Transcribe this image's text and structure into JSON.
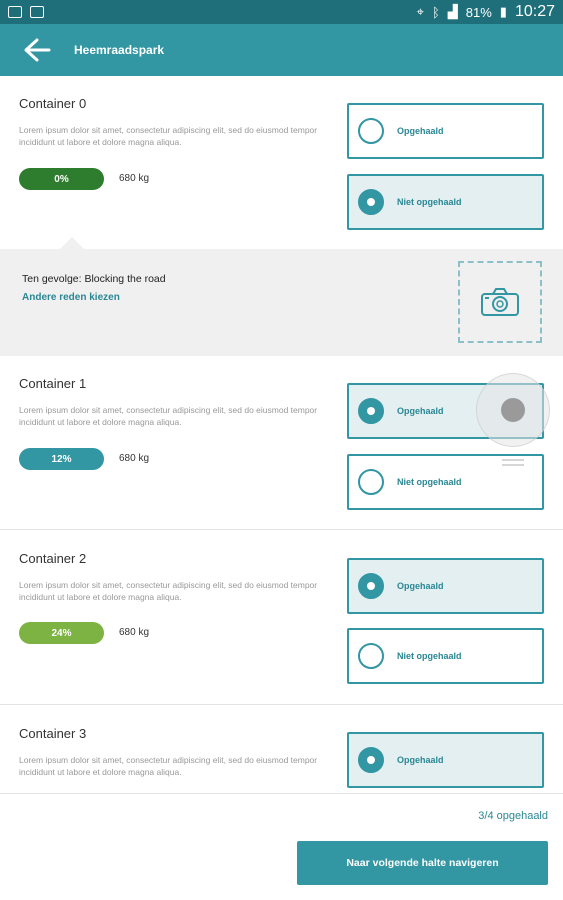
{
  "status_bar": {
    "battery": "81%",
    "time": "10:27"
  },
  "app_bar": {
    "title": "Heemraadspark"
  },
  "containers": [
    {
      "title": "Container 0",
      "description": "Lorem ipsum dolor sit amet, consectetur adipiscing elit, sed do eiusmod tempor incididunt ut labore et dolore magna aliqua.",
      "fill_percent": "0%",
      "fill_color": "#2e7d2e",
      "weight": "680 kg",
      "options": [
        {
          "label": "Opgehaald",
          "selected": false
        },
        {
          "label": "Niet opgehaald",
          "selected": true
        }
      ]
    },
    {
      "title": "Container 1",
      "description": "Lorem ipsum dolor sit amet, consectetur adipiscing elit, sed do eiusmod tempor incididunt ut labore et dolore magna aliqua.",
      "fill_percent": "12%",
      "fill_color": "#3296a3",
      "weight": "680 kg",
      "options": [
        {
          "label": "Opgehaald",
          "selected": true
        },
        {
          "label": "Niet opgehaald",
          "selected": false
        }
      ]
    },
    {
      "title": "Container 2",
      "description": "Lorem ipsum dolor sit amet, consectetur adipiscing elit, sed do eiusmod tempor incididunt ut labore et dolore magna aliqua.",
      "fill_percent": "24%",
      "fill_color": "#7cb342",
      "weight": "680 kg",
      "options": [
        {
          "label": "Opgehaald",
          "selected": true
        },
        {
          "label": "Niet opgehaald",
          "selected": false
        }
      ]
    },
    {
      "title": "Container 3",
      "description": "Lorem ipsum dolor sit amet, consectetur adipiscing elit, sed do eiusmod tempor incididunt ut labore et dolore magna aliqua.",
      "options": [
        {
          "label": "Opgehaald",
          "selected": true
        }
      ]
    }
  ],
  "reason": {
    "text": "Ten gevolge: Blocking the road",
    "link": "Andere reden kiezen"
  },
  "footer": {
    "count": "3/4 opgehaald",
    "button": "Naar volgende halte navigeren"
  },
  "colors": {
    "primary": "#3296a3",
    "status_bar": "#1f6f7b",
    "selected_bg": "#e3eff1"
  }
}
